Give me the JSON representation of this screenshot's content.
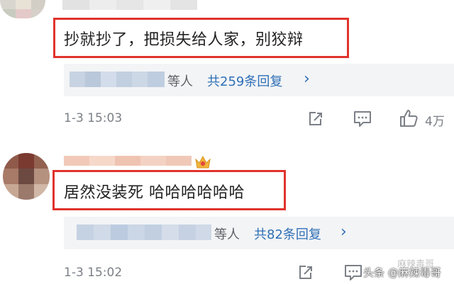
{
  "comments": [
    {
      "text": "抄就抄了，把损失给人家，别狡辩",
      "reply_who": "等人",
      "reply_count_label": "共259条回复",
      "reply_chevron": "›",
      "time": "1-3 15:03",
      "likes": "4万"
    },
    {
      "text": "居然没装死 哈哈哈哈哈哈",
      "reply_who": "等人",
      "reply_count_label": "共82条回复",
      "reply_chevron": "›",
      "time": "1-3 15:02",
      "likes": ""
    }
  ],
  "watermark": {
    "faint": "麻辣毒哥",
    "main": "头条 @麻辣毒哥"
  },
  "colors": {
    "highlight_border": "#e0332c",
    "link": "#2f6fb6",
    "reply_panel": "#f3f4f6"
  },
  "icons": [
    "share-icon",
    "comment-icon",
    "thumbs-up-icon",
    "crown-badge-icon"
  ]
}
